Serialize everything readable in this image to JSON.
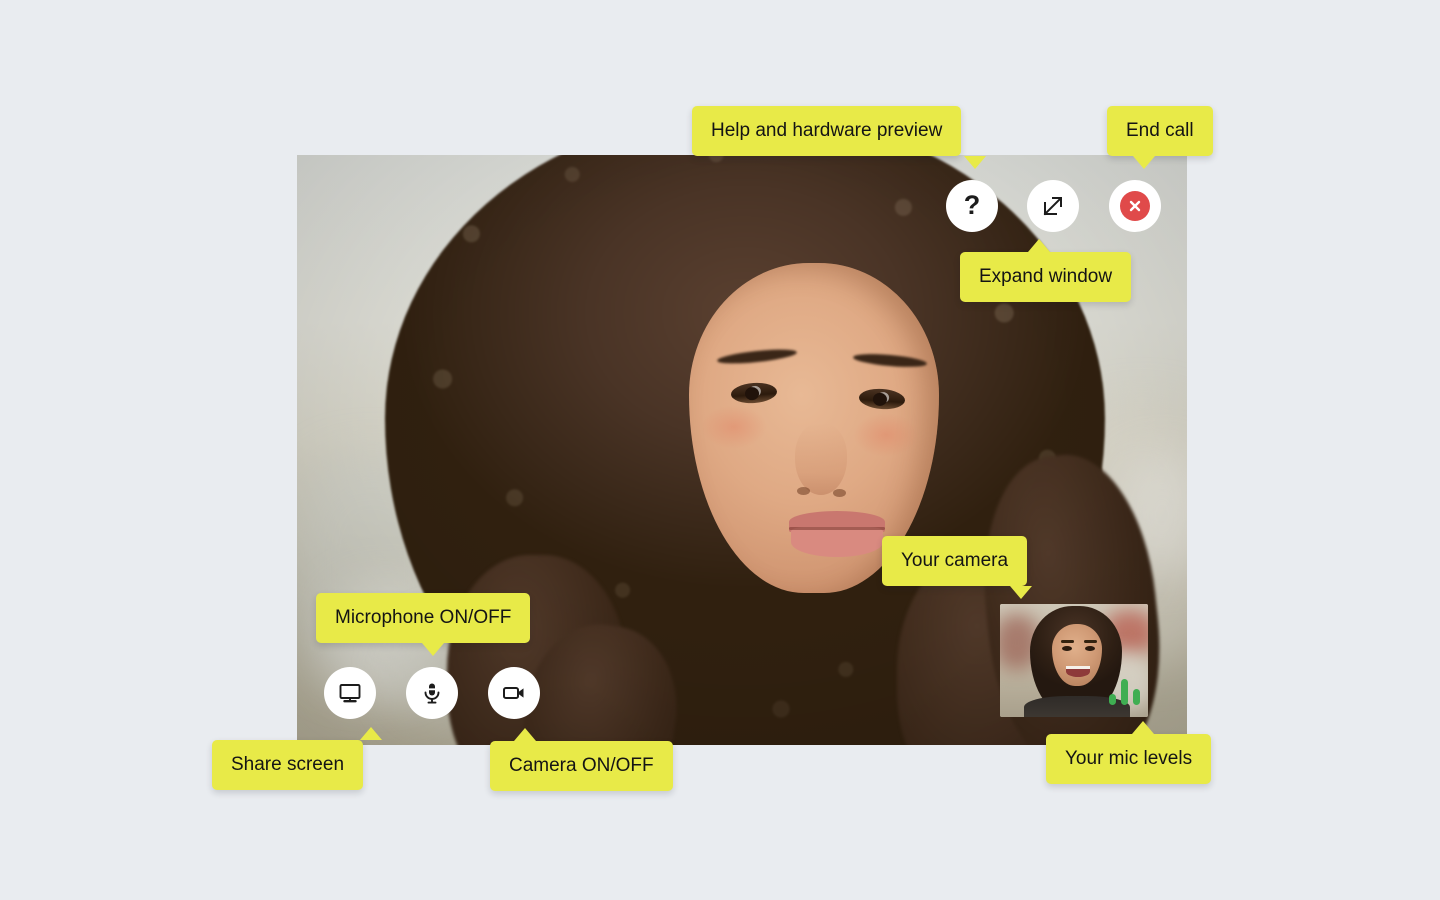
{
  "page": {
    "background_color": "#e9ecf0",
    "tooltip_color": "#e8ea48",
    "tooltip_text_color": "#141414",
    "end_call_accent": "#e04a4a",
    "mic_level_color": "#3fae52",
    "button_bg": "#ffffff"
  },
  "call_window": {
    "remote_participant_label": "remote-video-feed",
    "self_view_label": "self-view-thumbnail"
  },
  "controls": {
    "top_right": [
      {
        "id": "help",
        "icon": "question-mark-icon",
        "glyph": "?",
        "label": "Help and hardware preview"
      },
      {
        "id": "expand",
        "icon": "expand-window-icon",
        "label": "Expand window"
      },
      {
        "id": "end_call",
        "icon": "end-call-icon",
        "label": "End call"
      }
    ],
    "bottom_left": [
      {
        "id": "share_screen",
        "icon": "monitor-icon",
        "label": "Share screen"
      },
      {
        "id": "microphone",
        "icon": "microphone-muted-icon",
        "label": "Microphone ON/OFF"
      },
      {
        "id": "camera",
        "icon": "video-camera-icon",
        "label": "Camera ON/OFF"
      }
    ]
  },
  "tooltips": {
    "help": "Help and hardware preview",
    "end_call": "End call",
    "expand_window": "Expand window",
    "your_camera": "Your camera",
    "microphone": "Microphone ON/OFF",
    "share_screen": "Share screen",
    "camera": "Camera ON/OFF",
    "your_mic_levels": "Your mic levels"
  },
  "mic_levels": {
    "bars": [
      11,
      26,
      16
    ],
    "max": 32
  }
}
